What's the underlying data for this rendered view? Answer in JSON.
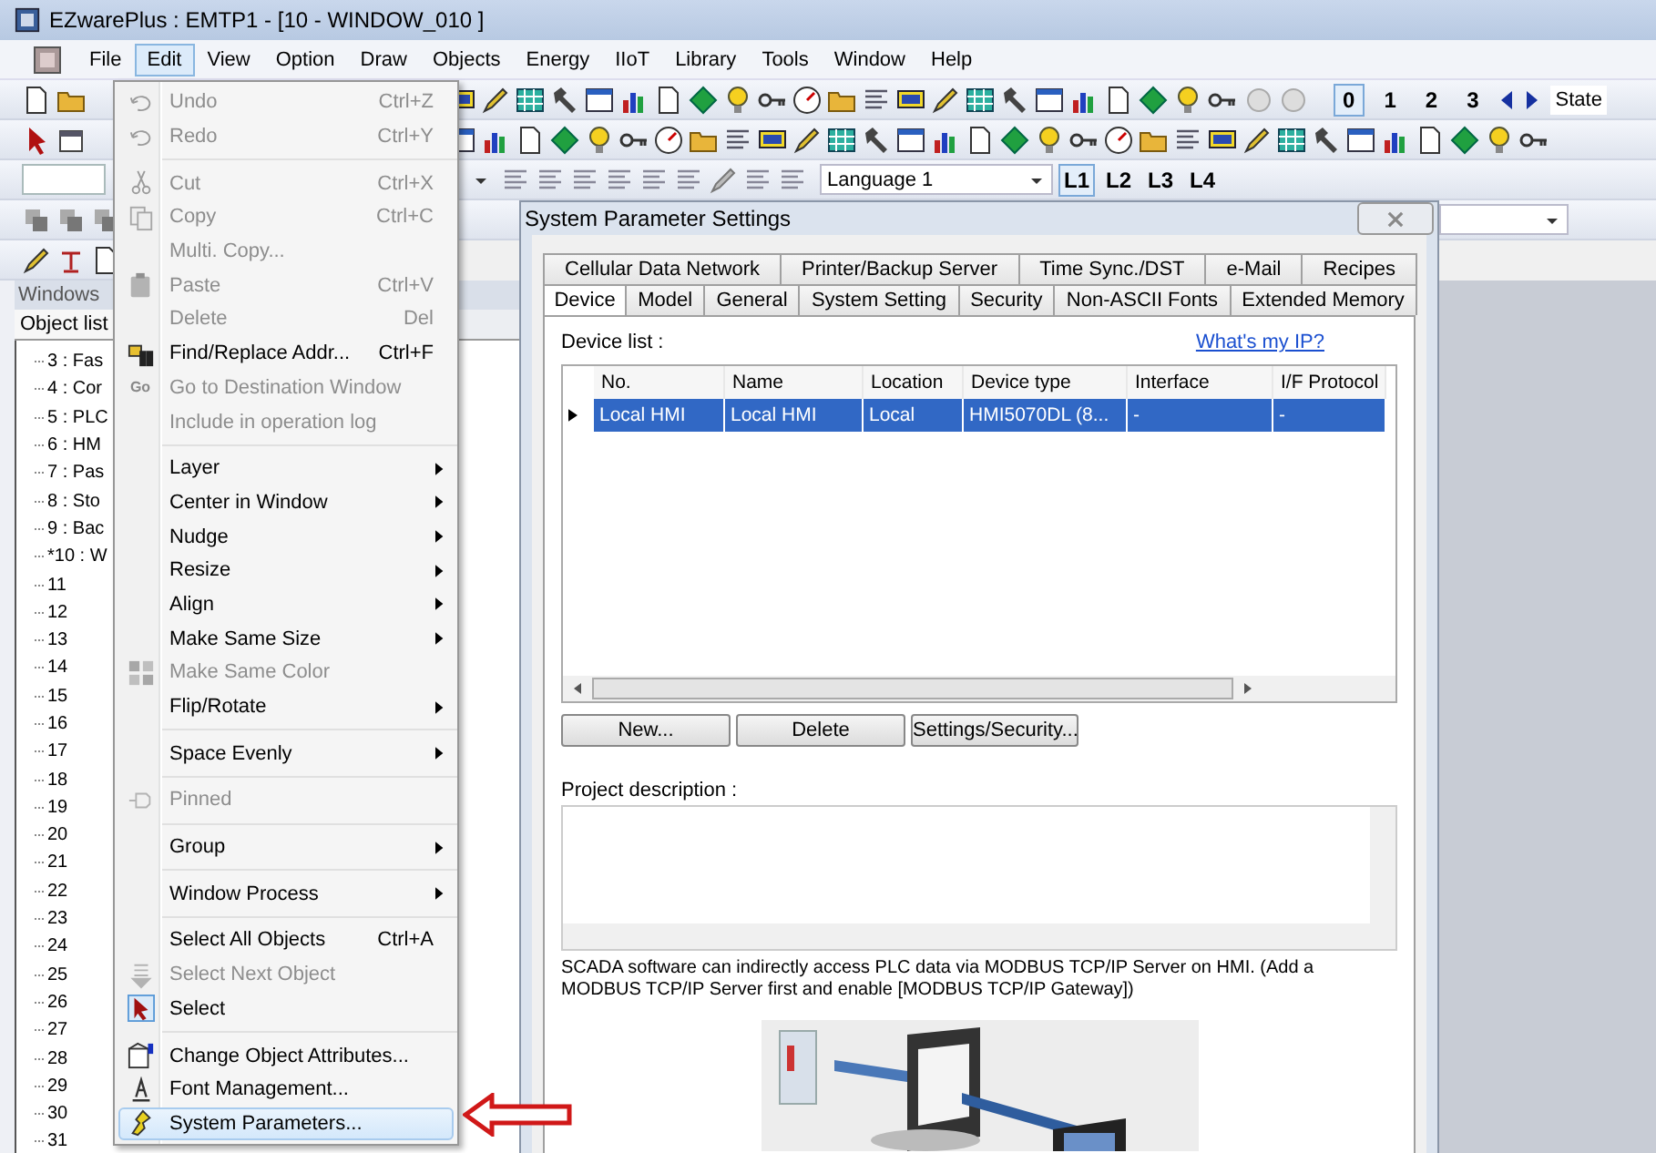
{
  "window": {
    "title": "EZwarePlus : EMTP1 - [10 - WINDOW_010 ]"
  },
  "menu_bar": [
    {
      "label": "File",
      "selected": false
    },
    {
      "label": "Edit",
      "selected": true
    },
    {
      "label": "View",
      "selected": false
    },
    {
      "label": "Option",
      "selected": false
    },
    {
      "label": "Draw",
      "selected": false
    },
    {
      "label": "Objects",
      "selected": false
    },
    {
      "label": "Energy",
      "selected": false
    },
    {
      "label": "IIoT",
      "selected": false
    },
    {
      "label": "Library",
      "selected": false
    },
    {
      "label": "Tools",
      "selected": false
    },
    {
      "label": "Window",
      "selected": false
    },
    {
      "label": "Help",
      "selected": false
    }
  ],
  "toolbar": {
    "state_buttons": [
      {
        "label": "0",
        "selected": true
      },
      {
        "label": "1",
        "selected": false
      },
      {
        "label": "2",
        "selected": false
      },
      {
        "label": "3",
        "selected": false
      }
    ],
    "state_label": "State",
    "language": "Language 1",
    "language_buttons": [
      {
        "label": "L1",
        "selected": true
      },
      {
        "label": "L2",
        "selected": false
      },
      {
        "label": "L3",
        "selected": false
      },
      {
        "label": "L4",
        "selected": false
      }
    ]
  },
  "panel": {
    "header": "Windows",
    "tab": "Object list",
    "tree": [
      {
        "label": "3 : Fas"
      },
      {
        "label": "4 : Cor"
      },
      {
        "label": "5 : PLC"
      },
      {
        "label": "6 : HM"
      },
      {
        "label": "7 : Pas"
      },
      {
        "label": "8 : Sto"
      },
      {
        "label": "9 : Bac"
      },
      {
        "label": "*10 : W"
      },
      {
        "label": "11"
      },
      {
        "label": "12"
      },
      {
        "label": "13"
      },
      {
        "label": "14"
      },
      {
        "label": "15"
      },
      {
        "label": "16"
      },
      {
        "label": "17"
      },
      {
        "label": "18"
      },
      {
        "label": "19"
      },
      {
        "label": "20"
      },
      {
        "label": "21"
      },
      {
        "label": "22"
      },
      {
        "label": "23"
      },
      {
        "label": "24"
      },
      {
        "label": "25"
      },
      {
        "label": "26"
      },
      {
        "label": "27"
      },
      {
        "label": "28"
      },
      {
        "label": "29"
      },
      {
        "label": "30"
      },
      {
        "label": "31"
      }
    ]
  },
  "edit_menu": [
    {
      "kind": "item",
      "label": "Undo",
      "shortcut": "Ctrl+Z",
      "disabled": true,
      "submenu": false,
      "selected": false
    },
    {
      "kind": "item",
      "label": "Redo",
      "shortcut": "Ctrl+Y",
      "disabled": true,
      "submenu": false,
      "selected": false
    },
    {
      "kind": "separator"
    },
    {
      "kind": "item",
      "label": "Cut",
      "shortcut": "Ctrl+X",
      "disabled": true,
      "submenu": false,
      "selected": false
    },
    {
      "kind": "item",
      "label": "Copy",
      "shortcut": "Ctrl+C",
      "disabled": true,
      "submenu": false,
      "selected": false
    },
    {
      "kind": "item",
      "label": "Multi. Copy...",
      "disabled": true,
      "submenu": false,
      "selected": false
    },
    {
      "kind": "item",
      "label": "Paste",
      "shortcut": "Ctrl+V",
      "disabled": true,
      "submenu": false,
      "selected": false
    },
    {
      "kind": "item",
      "label": "Delete",
      "shortcut": "Del",
      "disabled": true,
      "submenu": false,
      "selected": false
    },
    {
      "kind": "item",
      "label": "Find/Replace Addr...",
      "shortcut": "Ctrl+F",
      "disabled": false,
      "submenu": false,
      "selected": false
    },
    {
      "kind": "item",
      "label": "Go to Destination Window",
      "icon_text": "Go",
      "disabled": true,
      "submenu": false,
      "selected": false
    },
    {
      "kind": "item",
      "label": "Include in operation log",
      "disabled": true,
      "submenu": false,
      "selected": false
    },
    {
      "kind": "separator"
    },
    {
      "kind": "item",
      "label": "Layer",
      "disabled": false,
      "submenu": true,
      "selected": false
    },
    {
      "kind": "item",
      "label": "Center in Window",
      "disabled": false,
      "submenu": true,
      "selected": false
    },
    {
      "kind": "item",
      "label": "Nudge",
      "disabled": false,
      "submenu": true,
      "selected": false
    },
    {
      "kind": "item",
      "label": "Resize",
      "disabled": false,
      "submenu": true,
      "selected": false
    },
    {
      "kind": "item",
      "label": "Align",
      "disabled": false,
      "submenu": true,
      "selected": false
    },
    {
      "kind": "item",
      "label": "Make Same Size",
      "disabled": false,
      "submenu": true,
      "selected": false
    },
    {
      "kind": "item",
      "label": "Make Same Color",
      "disabled": true,
      "submenu": false,
      "selected": false
    },
    {
      "kind": "item",
      "label": "Flip/Rotate",
      "disabled": false,
      "submenu": true,
      "selected": false
    },
    {
      "kind": "separator"
    },
    {
      "kind": "item",
      "label": "Space Evenly",
      "disabled": false,
      "submenu": true,
      "selected": false
    },
    {
      "kind": "separator"
    },
    {
      "kind": "item",
      "label": "Pinned",
      "disabled": true,
      "submenu": false,
      "selected": false
    },
    {
      "kind": "separator"
    },
    {
      "kind": "item",
      "label": "Group",
      "disabled": false,
      "submenu": true,
      "selected": false
    },
    {
      "kind": "separator"
    },
    {
      "kind": "item",
      "label": "Window Process",
      "disabled": false,
      "submenu": true,
      "selected": false
    },
    {
      "kind": "separator"
    },
    {
      "kind": "item",
      "label": "Select All Objects",
      "shortcut": "Ctrl+A",
      "disabled": false,
      "submenu": false,
      "selected": false
    },
    {
      "kind": "item",
      "label": "Select Next Object",
      "disabled": true,
      "submenu": false,
      "selected": false
    },
    {
      "kind": "item",
      "label": "Select",
      "disabled": false,
      "submenu": false,
      "selected": false
    },
    {
      "kind": "separator"
    },
    {
      "kind": "item",
      "label": "Change Object Attributes...",
      "disabled": false,
      "submenu": false,
      "selected": false
    },
    {
      "kind": "item",
      "label": "Font Management...",
      "disabled": false,
      "submenu": false,
      "selected": false
    },
    {
      "kind": "item",
      "label": "System Parameters...",
      "disabled": false,
      "submenu": false,
      "selected": true
    }
  ],
  "dialog": {
    "title": "System Parameter Settings",
    "tab_rows": [
      [
        {
          "label": "Cellular Data Network",
          "selected": false
        },
        {
          "label": "Printer/Backup Server",
          "selected": false
        },
        {
          "label": "Time Sync./DST",
          "selected": false
        },
        {
          "label": "e-Mail",
          "selected": false
        },
        {
          "label": "Recipes",
          "selected": false
        }
      ],
      [
        {
          "label": "Device",
          "selected": true
        },
        {
          "label": "Model",
          "selected": false
        },
        {
          "label": "General",
          "selected": false
        },
        {
          "label": "System Setting",
          "selected": false
        },
        {
          "label": "Security",
          "selected": false
        },
        {
          "label": "Non-ASCII Fonts",
          "selected": false
        },
        {
          "label": "Extended Memory",
          "selected": false
        }
      ]
    ],
    "device_list_label": "Device list :",
    "link": "What's my IP?",
    "columns": [
      "No.",
      "Name",
      "Location",
      "Device type",
      "Interface",
      "I/F Protocol"
    ],
    "rows": [
      {
        "selected": true,
        "cells": [
          "Local HMI",
          "Local HMI",
          "Local",
          "HMI5070DL (8...",
          "-",
          "-"
        ]
      }
    ],
    "buttons": [
      "New...",
      "Delete",
      "Settings/Security..."
    ],
    "description_label": "Project description :",
    "note": "SCADA software can indirectly access PLC data via MODBUS TCP/IP Server on HMI. (Add a MODBUS TCP/IP Server first and enable [MODBUS TCP/IP Gateway])",
    "illustration": {
      "kind": "picture"
    }
  }
}
